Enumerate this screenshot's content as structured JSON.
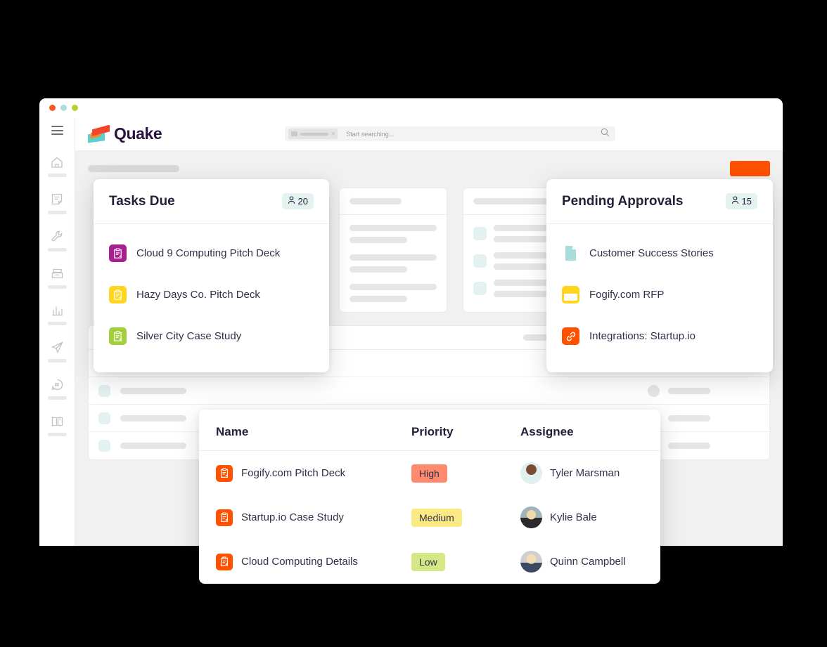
{
  "window": {
    "traffic_lights": [
      "#ff5722",
      "#a9dde0",
      "#b4d333"
    ]
  },
  "app": {
    "logo_text": "Quake",
    "menu_icon": "hamburger-icon"
  },
  "search": {
    "placeholder": "Start searching...",
    "chip_close": "×",
    "search_icon": "magnifier-icon"
  },
  "sidebar": {
    "items": [
      {
        "icon": "home-icon"
      },
      {
        "icon": "note-icon"
      },
      {
        "icon": "wrench-icon"
      },
      {
        "icon": "file-box-icon"
      },
      {
        "icon": "bar-chart-icon"
      },
      {
        "icon": "paper-plane-icon"
      },
      {
        "icon": "chat-hash-icon"
      },
      {
        "icon": "book-icon"
      }
    ]
  },
  "toolbar": {
    "primary_button_color": "#ff5100"
  },
  "tasks_card": {
    "title": "Tasks Due",
    "badge_count": "20",
    "badge_icon": "person-icon",
    "badge_bg": "#e4f2f0",
    "items": [
      {
        "label": "Cloud 9 Computing Pitch Deck",
        "icon": "clipboard-check-icon",
        "color": "#a81f8f"
      },
      {
        "label": "Hazy Days Co. Pitch Deck",
        "icon": "clipboard-check-icon",
        "color": "#ffd520"
      },
      {
        "label": "Silver City Case Study",
        "icon": "clipboard-check-icon",
        "color": "#a3cf3f"
      }
    ]
  },
  "approvals_card": {
    "title": "Pending Approvals",
    "badge_count": "15",
    "badge_icon": "person-icon",
    "badge_bg": "#e4f2f0",
    "items": [
      {
        "label": "Customer Success Stories",
        "icon": "document-icon",
        "color": "#aadcdc"
      },
      {
        "label": "Fogify.com RFP",
        "icon": "folder-icon",
        "color": "#ffd520"
      },
      {
        "label": "Integrations: Startup.io",
        "icon": "link-icon",
        "color": "#ff5100"
      }
    ]
  },
  "table_card": {
    "columns": [
      "Name",
      "Priority",
      "Assignee"
    ],
    "rows": [
      {
        "name": "Fogify.com Pitch Deck",
        "name_icon": "clipboard-check-icon",
        "name_icon_color": "#ff5100",
        "priority": "High",
        "priority_bg": "#ff8a6e",
        "assignee": "Tyler Marsman"
      },
      {
        "name": "Startup.io Case Study",
        "name_icon": "clipboard-check-icon",
        "name_icon_color": "#ff5100",
        "priority": "Medium",
        "priority_bg": "#fbe984",
        "assignee": "Kylie Bale"
      },
      {
        "name": "Cloud Computing Details",
        "name_icon": "clipboard-check-icon",
        "name_icon_color": "#ff5100",
        "priority": "Low",
        "priority_bg": "#d5e886",
        "assignee": "Quinn Campbell"
      }
    ]
  }
}
